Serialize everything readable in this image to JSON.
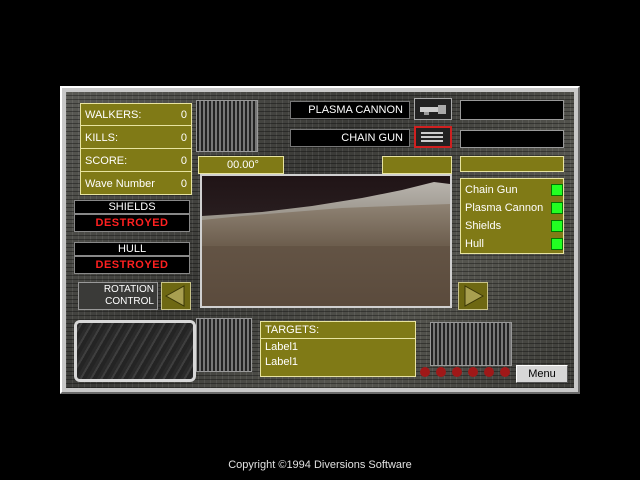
{
  "stats": [
    {
      "label": "WALKERS:",
      "value": "0"
    },
    {
      "label": "KILLS:",
      "value": "0"
    },
    {
      "label": "SCORE:",
      "value": "0"
    },
    {
      "label": "Wave Number",
      "value": "0"
    }
  ],
  "shields": {
    "label": "SHIELDS",
    "status": "DESTROYED"
  },
  "hull": {
    "label": "HULL",
    "status": "DESTROYED"
  },
  "rotation": {
    "line1": "ROTATION",
    "line2": "CONTROL"
  },
  "weapons": {
    "primary": "PLASMA CANNON",
    "secondary": "CHAIN GUN"
  },
  "heading": "00.00°",
  "systems": [
    {
      "label": "Chain Gun"
    },
    {
      "label": "Plasma Cannon"
    },
    {
      "label": "Shields"
    },
    {
      "label": "Hull"
    }
  ],
  "targets": {
    "title": "TARGETS:",
    "items": [
      "Label1",
      "Label1"
    ]
  },
  "menu_label": "Menu",
  "copyright": "Copyright ©1994 Diversions Software",
  "colors": {
    "panel_olive": "#807a16",
    "status_red": "#ff2020",
    "led_green": "#22ff22"
  },
  "icons": {
    "plasma": "plasma-cannon-icon",
    "chain": "chain-gun-icon"
  }
}
